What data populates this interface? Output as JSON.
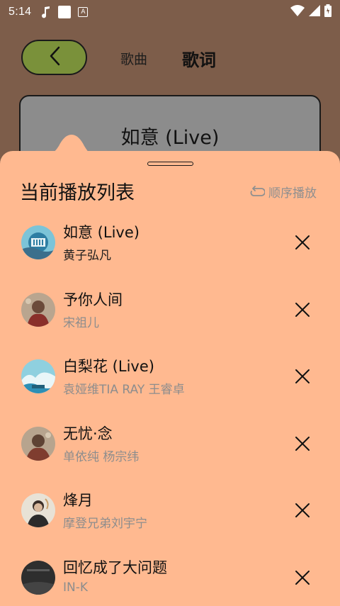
{
  "status_bar": {
    "time": "5:14"
  },
  "header": {
    "tab_song": "歌曲",
    "tab_lyrics": "歌词"
  },
  "now_playing": {
    "title": "如意 (Live)"
  },
  "playlist": {
    "title": "当前播放列表",
    "play_mode": "顺序播放",
    "items": [
      {
        "title": "如意 (Live)",
        "artist": "黄子弘凡"
      },
      {
        "title": "予你人间",
        "artist": "宋祖儿"
      },
      {
        "title": "白梨花 (Live)",
        "artist": "袁娅维TIA RAY 王睿卓"
      },
      {
        "title": "无忧·念",
        "artist": "单依纯 杨宗纬"
      },
      {
        "title": "烽月",
        "artist": "摩登兄弟刘宇宁"
      },
      {
        "title": "回忆成了大问题",
        "artist": "IN-K"
      }
    ]
  },
  "colors": {
    "background": "#7d5d4a",
    "sheet": "#ffb990",
    "back_button": "#7a913a",
    "title_card": "#8c8c8c"
  }
}
